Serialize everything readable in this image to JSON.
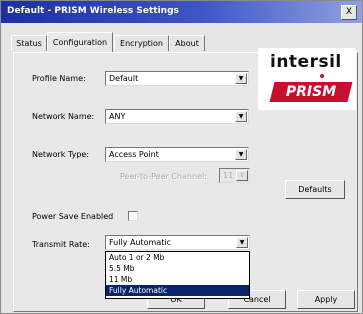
{
  "window": {
    "title": "Default - PRISM Wireless Settings",
    "close_glyph": "X"
  },
  "tabs": [
    {
      "label": "Status"
    },
    {
      "label": "Configuration"
    },
    {
      "label": "Encryption"
    },
    {
      "label": "About"
    }
  ],
  "logo": {
    "brand": "intersil",
    "product": "PRISM",
    "accent": "#c8102e"
  },
  "form": {
    "profile_name_label": "Profile Name:",
    "profile_name_value": "Default",
    "network_name_label": "Network Name:",
    "network_name_value": "ANY",
    "network_type_label": "Network Type:",
    "network_type_value": "Access Point",
    "ad_hoc_channel_label": "Peer-to-Peer Channel:",
    "ad_hoc_channel_value": "11",
    "power_save_label": "Power Save Enabled",
    "power_save_checked": false,
    "transmit_rate_label": "Transmit Rate:",
    "transmit_rate_value": "Fully Automatic"
  },
  "transmit_rate_options": [
    {
      "label": "Auto 1 or 2 Mb"
    },
    {
      "label": "5.5 Mb"
    },
    {
      "label": "11 Mb"
    },
    {
      "label": "Fully Automatic"
    }
  ],
  "buttons": {
    "defaults": "Defaults",
    "ok": "OK",
    "cancel": "Cancel",
    "apply": "Apply"
  },
  "colors": {
    "titlebar_start": "#1c2fa3",
    "selection": "#0a246a"
  }
}
